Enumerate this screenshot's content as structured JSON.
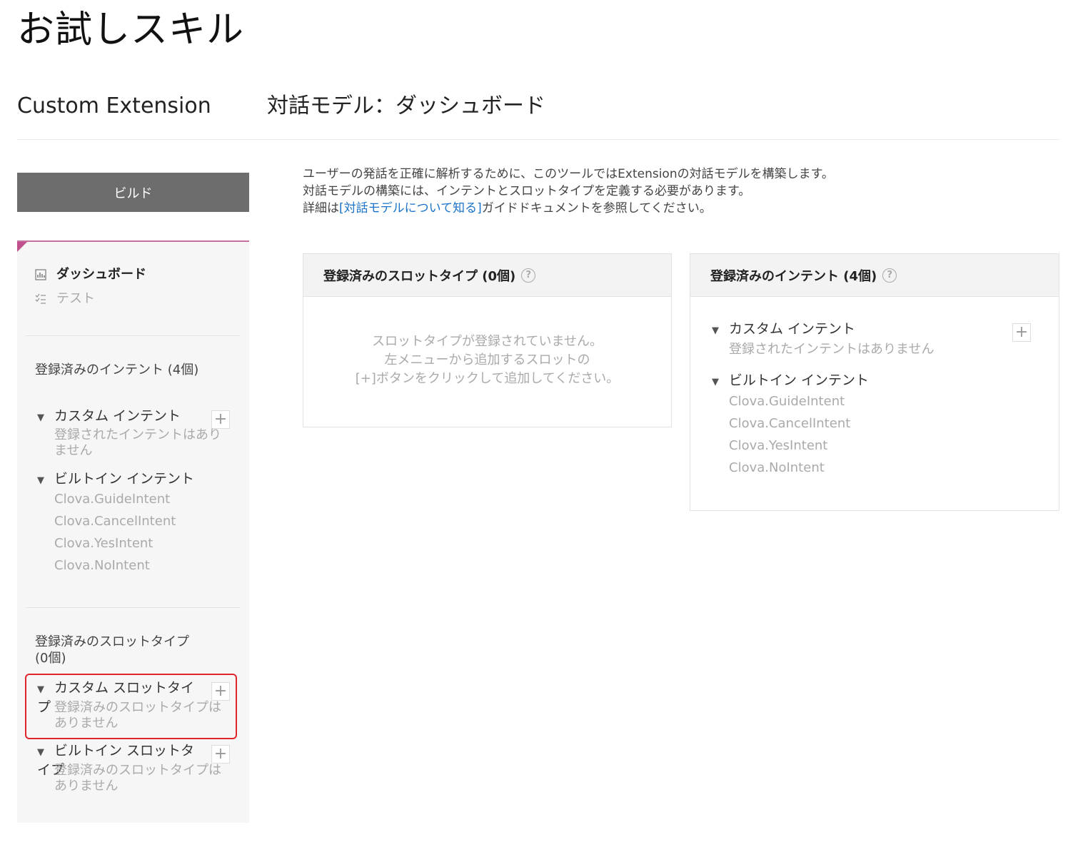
{
  "header": {
    "skill_title": "お試しスキル",
    "ext_title": "Custom Extension",
    "page_title": "対話モデル：ダッシュボード"
  },
  "build_button": "ビルド",
  "sidebar": {
    "nav": [
      {
        "label": "ダッシュボード",
        "icon": "chart-icon"
      },
      {
        "label": "テスト",
        "icon": "checklist-icon"
      }
    ],
    "intents_heading": "登録済みのインテント (4個)",
    "custom_intent_label": "カスタム インテント",
    "custom_intent_empty": "登録されたインテントはありません",
    "builtin_intent_label": "ビルトイン インテント",
    "builtin_intents": [
      "Clova.GuideIntent",
      "Clova.CancelIntent",
      "Clova.YesIntent",
      "Clova.NoIntent"
    ],
    "slots_heading": "登録済みのスロットタイプ (0個)",
    "custom_slot_label": "カスタム スロットタイプ",
    "custom_slot_empty": "登録済みのスロットタイプはありません",
    "builtin_slot_label": "ビルトイン スロットタイプ",
    "builtin_slot_empty": "登録済みのスロットタイプはありません",
    "plus": "+"
  },
  "description": {
    "line1": "ユーザーの発話を正確に解析するために、このツールではExtensionの対話モデルを構築します。",
    "line2": "対話モデルの構築には、インテントとスロットタイプを定義する必要があります。",
    "line3_prefix": "詳細は",
    "line3_link": "[対話モデルについて知る]",
    "line3_suffix": "ガイドドキュメントを参照してください。"
  },
  "slot_panel": {
    "title": "登録済みのスロットタイプ (0個)",
    "help": "?",
    "empty_line1": "スロットタイプが登録されていません。",
    "empty_line2": "左メニューから追加するスロットの",
    "empty_line3": "[+]ボタンをクリックして追加してください。"
  },
  "intent_panel": {
    "title": "登録済みのインテント (4個)",
    "help": "?",
    "custom_label": "カスタム インテント",
    "custom_empty": "登録されたインテントはありません",
    "builtin_label": "ビルトイン インテント",
    "builtin_intents": [
      "Clova.GuideIntent",
      "Clova.CancelIntent",
      "Clova.YesIntent",
      "Clova.NoIntent"
    ],
    "plus": "+"
  },
  "colors": {
    "accent": "#c0508b",
    "build_button": "#6d6d6d",
    "link": "#1a73c9",
    "highlight": "#e0242c"
  }
}
